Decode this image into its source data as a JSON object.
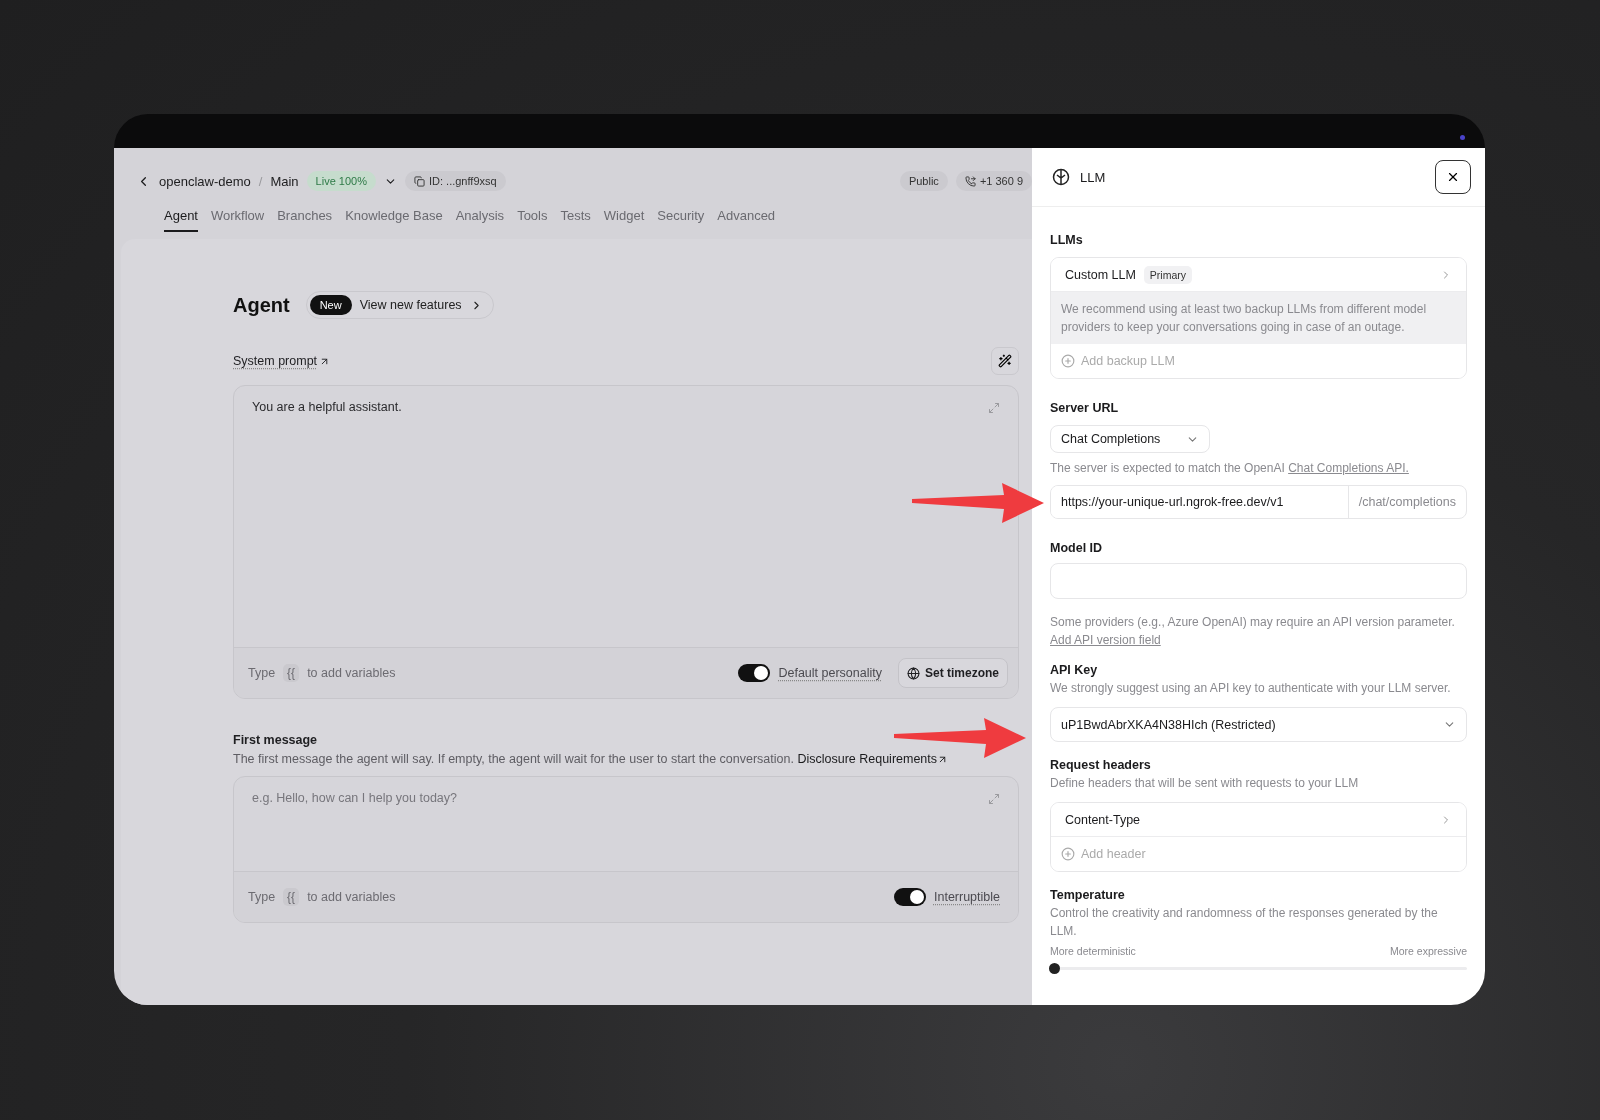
{
  "header": {
    "project": "openclaw-demo",
    "separator": "/",
    "branch": "Main",
    "status_badge": "Live 100%",
    "id_chip": "ID: ...gnff9xsq",
    "visibility": "Public",
    "phone": "+1 360 9"
  },
  "tabs": [
    {
      "label": "Agent",
      "selected": true
    },
    {
      "label": "Workflow",
      "selected": false
    },
    {
      "label": "Branches",
      "selected": false
    },
    {
      "label": "Knowledge Base",
      "selected": false
    },
    {
      "label": "Analysis",
      "selected": false
    },
    {
      "label": "Tools",
      "selected": false
    },
    {
      "label": "Tests",
      "selected": false
    },
    {
      "label": "Widget",
      "selected": false
    },
    {
      "label": "Security",
      "selected": false
    },
    {
      "label": "Advanced",
      "selected": false
    }
  ],
  "agent": {
    "title": "Agent",
    "new_badge": "New",
    "features_link": "View new features"
  },
  "system_prompt": {
    "label": "System prompt",
    "value": "You are a helpful assistant.",
    "hint_before": "Type",
    "hint_key": "{{",
    "hint_after": "to add variables",
    "toggle": {
      "label": "Default personality",
      "on": true
    },
    "timezone_button": "Set timezone"
  },
  "first_message": {
    "label": "First message",
    "description": "The first message the agent will say. If empty, the agent will wait for the user to start the conversation.",
    "link": "Disclosure Requirements",
    "placeholder": "e.g. Hello, how can I help you today?",
    "hint_before": "Type",
    "hint_key": "{{",
    "hint_after": "to add variables",
    "toggle": {
      "label": "Interruptible",
      "on": true
    }
  },
  "llm_panel": {
    "title": "LLM",
    "llms": {
      "label": "LLMs",
      "name": "Custom LLM",
      "tag": "Primary",
      "note": "We recommend using at least two backup LLMs from different model providers to keep your conversations going in case of an outage.",
      "add": "Add backup LLM"
    },
    "server_url": {
      "label": "Server URL",
      "type": "Chat Completions",
      "note": "The server is expected to match the OpenAI",
      "note_link": "Chat Completions API.",
      "value": "https://your-unique-url.ngrok-free.dev/v1",
      "suffix": "/chat/completions"
    },
    "model_id": {
      "label": "Model ID",
      "note": "Some providers (e.g., Azure OpenAI) may require an API version parameter.",
      "note_link": "Add API version field"
    },
    "api_key": {
      "label": "API Key",
      "note": "We strongly suggest using an API key to authenticate with your LLM server.",
      "value": "uP1BwdAbrXKA4N38HIch (Restricted)"
    },
    "request_headers": {
      "label": "Request headers",
      "note": "Define headers that will be sent with requests to your LLM",
      "items": [
        "Content-Type"
      ],
      "add": "Add header"
    },
    "temperature": {
      "label": "Temperature",
      "note": "Control the creativity and randomness of the responses generated by the LLM.",
      "min_label": "More deterministic",
      "max_label": "More expressive",
      "level": 0
    }
  }
}
